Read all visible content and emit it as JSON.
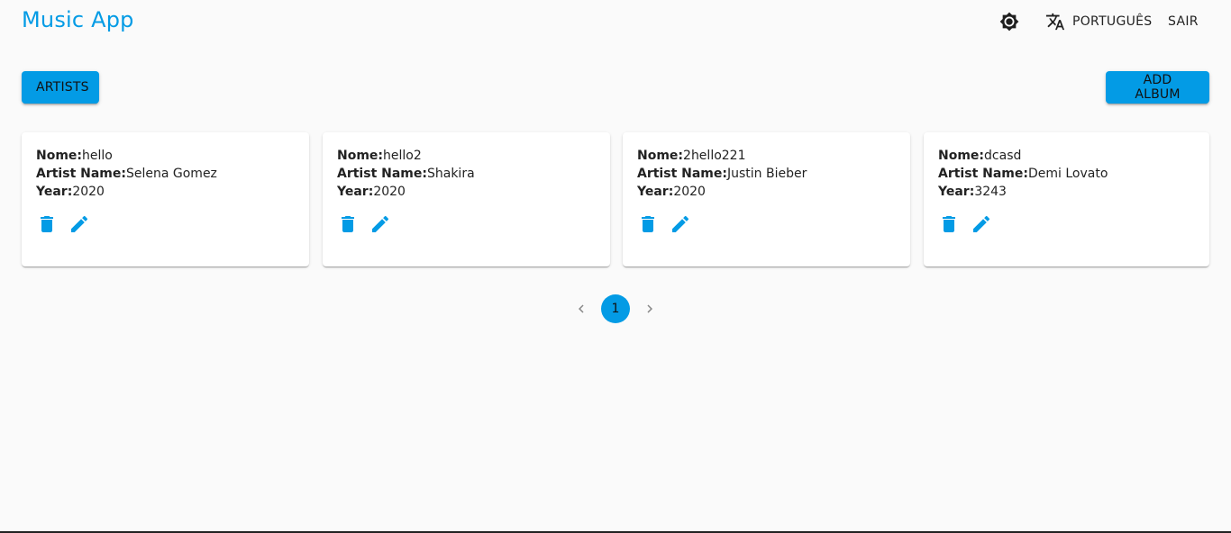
{
  "header": {
    "title": "Music App",
    "theme_icon": "brightness-icon",
    "language_label": "PORTUGUÊS",
    "language_icon": "translate-icon",
    "logout_label": "SAIR"
  },
  "toolbar": {
    "artists_label": "ARTISTS",
    "add_album_label": "ADD ALBUM"
  },
  "labels": {
    "nome": "Nome:",
    "artist_name": "Artist Name:",
    "year": "Year:"
  },
  "albums": [
    {
      "nome": "hello",
      "artist_name": "Selena Gomez",
      "year": "2020"
    },
    {
      "nome": "hello2",
      "artist_name": "Shakira",
      "year": "2020"
    },
    {
      "nome": "2hello221",
      "artist_name": "Justin Bieber",
      "year": "2020"
    },
    {
      "nome": "dcasd",
      "artist_name": "Demi Lovato",
      "year": "3243"
    }
  ],
  "pagination": {
    "current_page": "1",
    "prev_icon": "chevron-left-icon",
    "next_icon": "chevron-right-icon"
  },
  "colors": {
    "accent": "#039be5",
    "background": "#fafafa",
    "card": "#ffffff"
  }
}
